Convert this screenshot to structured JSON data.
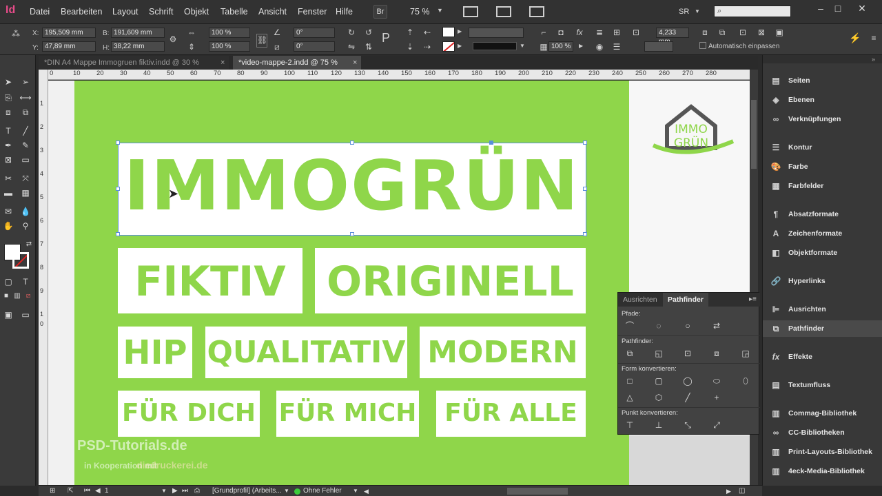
{
  "app": {
    "logo": "Id"
  },
  "menu": [
    "Datei",
    "Bearbeiten",
    "Layout",
    "Schrift",
    "Objekt",
    "Tabelle",
    "Ansicht",
    "Fenster",
    "Hilfe"
  ],
  "menubar": {
    "bridge": "Br",
    "zoom": "75 %",
    "workspace": "SR",
    "search_placeholder": ""
  },
  "control": {
    "x_label": "X:",
    "x_value": "195,509 mm",
    "y_label": "Y:",
    "y_value": "47,89 mm",
    "b_label": "B:",
    "b_value": "191,609 mm",
    "h_label": "H:",
    "h_value": "38,22 mm",
    "scale_x": "100 %",
    "scale_y": "100 %",
    "rotate": "0°",
    "shear": "0°",
    "stroke_weight": "4,233 mm",
    "opacity": "100 %",
    "auto_fit": "Automatisch einpassen"
  },
  "tabs": [
    {
      "label": "*DIN A4 Mappe Immogruen fiktiv.indd @ 30 %",
      "active": false
    },
    {
      "label": "*video-mappe-2.indd @ 75 %",
      "active": true
    }
  ],
  "ruler": {
    "top": [
      "0",
      "10",
      "20",
      "30",
      "40",
      "50",
      "60",
      "70",
      "80",
      "90",
      "100",
      "110",
      "120",
      "130",
      "140",
      "150",
      "160",
      "170",
      "180",
      "190",
      "200",
      "210",
      "220",
      "230",
      "240",
      "250",
      "260",
      "270",
      "280"
    ],
    "left": [
      "1",
      "2",
      "3",
      "4",
      "5",
      "6",
      "7",
      "8",
      "9",
      "1",
      "0"
    ]
  },
  "artwork": {
    "title": "IMMOGRÜN",
    "row1": [
      "FIKTIV",
      "ORIGINELL"
    ],
    "row2": [
      "HIP",
      "QUALITATIV",
      "MODERN"
    ],
    "row3": [
      "FÜR DICH",
      "FÜR MICH",
      "FÜR ALLE"
    ],
    "logo_line1": "IMMO",
    "logo_line2": "GRÜN",
    "brand_green": "#8fd64a",
    "logo_gray": "#555555"
  },
  "watermark": {
    "line1": "PSD-Tutorials.de",
    "line2": "in Kooperation mit",
    "line3": "diedruckerei.de"
  },
  "dock": {
    "items": [
      "Seiten",
      "Ebenen",
      "Verknüpfungen",
      "Kontur",
      "Farbe",
      "Farbfelder",
      "Absatzformate",
      "Zeichenformate",
      "Objektformate",
      "Hyperlinks",
      "Ausrichten",
      "Pathfinder",
      "Effekte",
      "Textumfluss",
      "Commag-Bibliothek",
      "CC-Bibliotheken",
      "Print-Layouts-Bibliothek",
      "4eck-Media-Bibliothek"
    ]
  },
  "pathfinder": {
    "tab_align": "Ausrichten",
    "tab_pathfinder": "Pathfinder",
    "sec_paths": "Pfade:",
    "sec_pathfinder": "Pathfinder:",
    "sec_convert_shape": "Form konvertieren:",
    "sec_convert_point": "Punkt konvertieren:"
  },
  "status": {
    "page": "1",
    "profile": "[Grundprofil] (Arbeits...",
    "preflight": "Ohne Fehler"
  }
}
